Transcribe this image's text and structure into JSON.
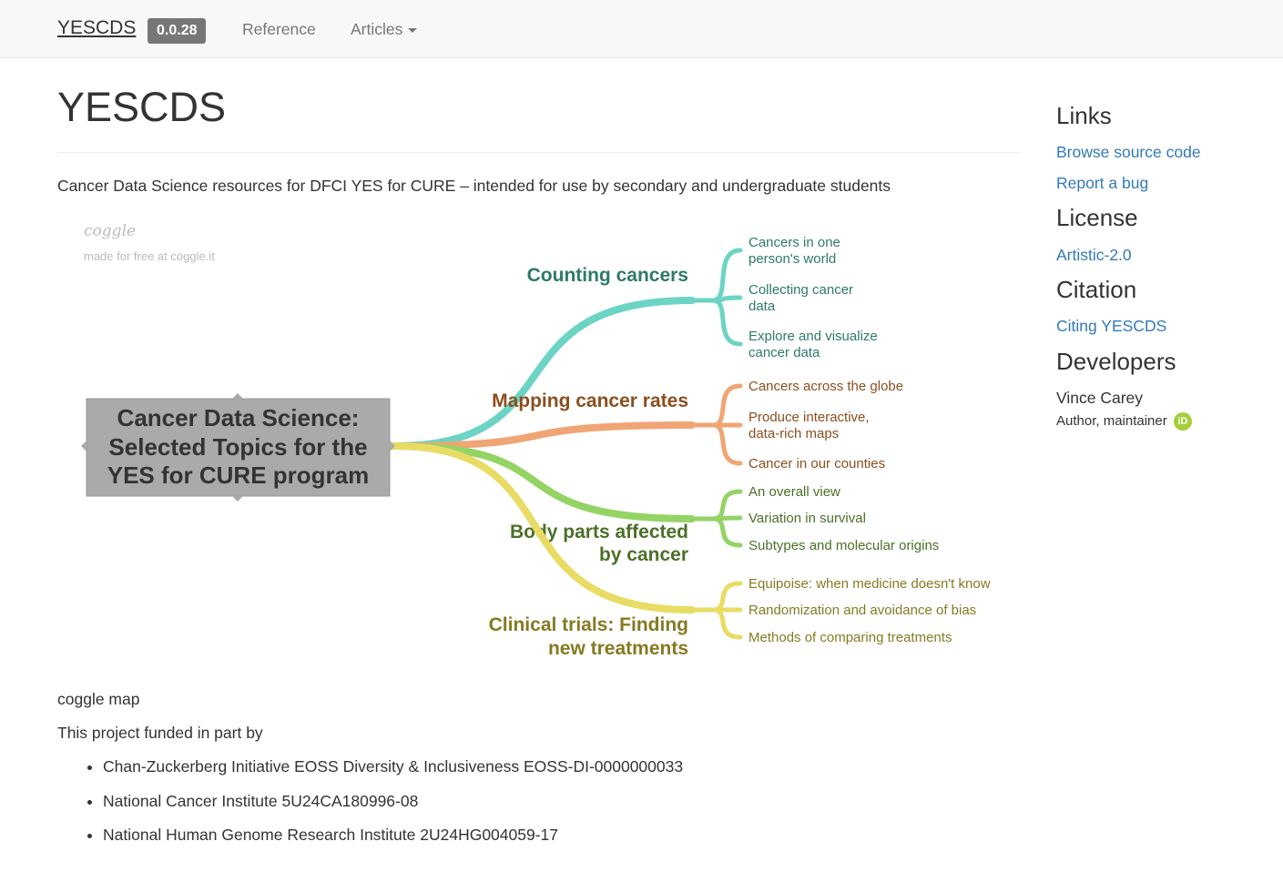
{
  "navbar": {
    "brand": "YESCDS",
    "version": "0.0.28",
    "reference_label": "Reference",
    "articles_label": "Articles"
  },
  "page": {
    "title": "YESCDS",
    "description": "Cancer Data Science resources for DFCI YES for CURE – intended for use by secondary and undergraduate students"
  },
  "coggle": {
    "logo": "coggle",
    "made_for_free": "made for free at coggle.it",
    "caption": "coggle map"
  },
  "mindmap": {
    "root": [
      "Cancer Data Science:",
      "Selected Topics for the",
      "YES for CURE program"
    ],
    "branches": [
      {
        "title": [
          "Counting cancers"
        ],
        "color": "#6cd4c4",
        "text_color": "#2e7a68",
        "leaves": [
          [
            "Cancers in one",
            "person's world"
          ],
          [
            "Collecting cancer",
            "data"
          ],
          [
            "Explore and visualize",
            "cancer data"
          ]
        ]
      },
      {
        "title": [
          "Mapping cancer rates"
        ],
        "color": "#f0a575",
        "text_color": "#8c4e1f",
        "leaves": [
          [
            "Cancers across the globe"
          ],
          [
            "Produce interactive,",
            "data-rich maps"
          ],
          [
            "Cancer in our counties"
          ]
        ]
      },
      {
        "title": [
          "Body parts affected",
          "by cancer"
        ],
        "color": "#93d465",
        "text_color": "#4b7028",
        "leaves": [
          [
            "An overall view"
          ],
          [
            "Variation in survival"
          ],
          [
            "Subtypes and molecular origins"
          ]
        ]
      },
      {
        "title": [
          "Clinical trials: Finding",
          "new treatments"
        ],
        "color": "#e8dc64",
        "text_color": "#867a22",
        "leaves": [
          [
            "Equipoise: when medicine doesn't know"
          ],
          [
            "Randomization and avoidance of bias"
          ],
          [
            "Methods of comparing treatments"
          ]
        ]
      }
    ]
  },
  "funding": {
    "intro": "This project funded in part by",
    "items": [
      "Chan-Zuckerberg Initiative EOSS Diversity & Inclusiveness EOSS-DI-0000000033",
      "National Cancer Institute 5U24CA180996-08",
      "National Human Genome Research Institute 2U24HG004059-17"
    ]
  },
  "sidebar": {
    "links_heading": "Links",
    "browse_source": "Browse source code",
    "report_bug": "Report a bug",
    "license_heading": "License",
    "license": "Artistic-2.0",
    "citation_heading": "Citation",
    "citing": "Citing YESCDS",
    "developers_heading": "Developers",
    "developer_name": "Vince Carey",
    "developer_role": "Author, maintainer",
    "orcid_badge": "iD"
  }
}
